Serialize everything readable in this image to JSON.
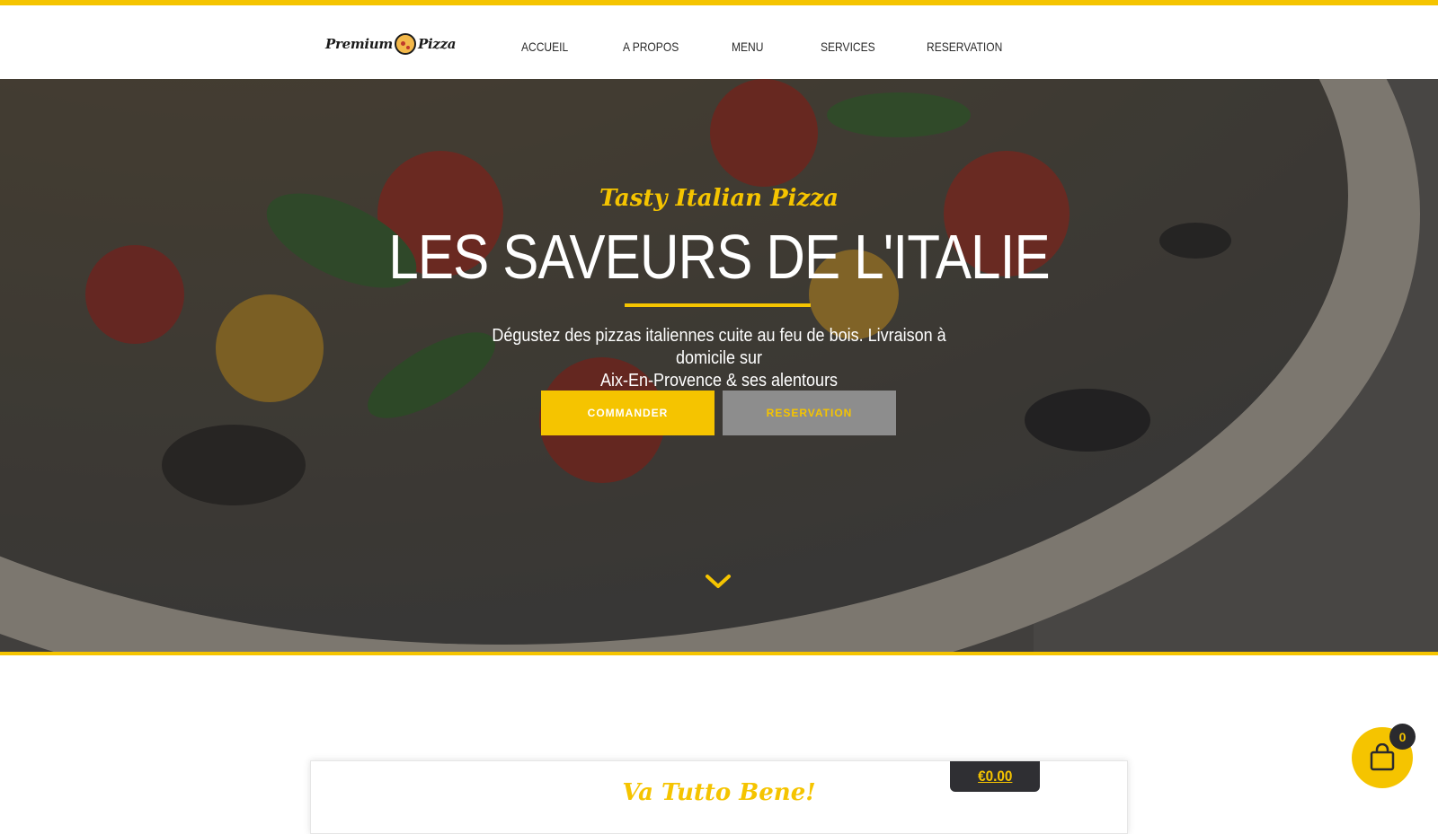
{
  "brand": {
    "logo_left": "Premium",
    "logo_right": "Pizza"
  },
  "nav": {
    "items": [
      "ACCUEIL",
      "A PROPOS",
      "MENU",
      "SERVICES",
      "RESERVATION"
    ]
  },
  "hero": {
    "tagline": "Tasty Italian Pizza",
    "headline": "LES SAVEURS DE L'ITALIE",
    "subtext_line1": "Dégustez des pizzas italiennes cuite au feu de bois. Livraison à domicile sur",
    "subtext_line2": "Aix-En-Provence & ses alentours",
    "btn_order": "COMMANDER",
    "btn_reserve": "RESERVATION"
  },
  "section": {
    "script_title": "Va Tutto Bene!"
  },
  "cart": {
    "total": "€0.00",
    "count": "0"
  },
  "colors": {
    "accent": "#f5c400",
    "dark": "#2f2f33",
    "button_gray": "#8d8d8d"
  },
  "icons": [
    "pizza-logo-icon",
    "chevron-down-icon",
    "shopping-bag-icon"
  ]
}
